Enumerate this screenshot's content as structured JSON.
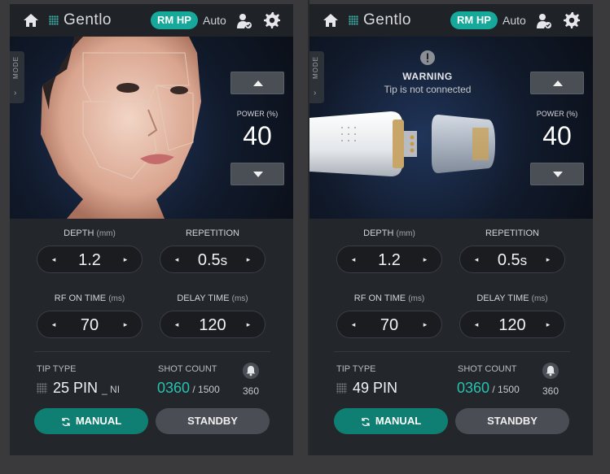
{
  "header": {
    "brand": "Gentlo",
    "mode_badge": "RM HP",
    "auto_label": "Auto"
  },
  "side_tab": {
    "label": "MODE",
    "chevron": "›"
  },
  "power": {
    "label": "POWER",
    "unit": "(%)",
    "value": "40"
  },
  "warning": {
    "title": "WARNING",
    "message": "Tip is not connected"
  },
  "controls": {
    "depth": {
      "label": "DEPTH",
      "unit": "(mm)",
      "value": "1.2"
    },
    "repetition": {
      "label": "REPETITION",
      "value": "0.5",
      "suffix": "s"
    },
    "rf_on_time": {
      "label": "RF ON TIME",
      "unit": "(ms)",
      "value": "70"
    },
    "delay_time": {
      "label": "DELAY TIME",
      "unit": "(ms)",
      "value": "120"
    },
    "left_arrow": "◂",
    "right_arrow": "▸"
  },
  "panels": [
    {
      "tip_type_label": "TIP TYPE",
      "tip_value": "25 PIN",
      "tip_suffix": "_ NI",
      "shot_label": "SHOT COUNT",
      "shot_current": "0360",
      "shot_total": " / 1500",
      "bell_count": "360"
    },
    {
      "tip_type_label": "TIP TYPE",
      "tip_value": "49 PIN",
      "tip_suffix": "",
      "shot_label": "SHOT COUNT",
      "shot_current": "0360",
      "shot_total": " / 1500",
      "bell_count": "360"
    }
  ],
  "buttons": {
    "manual": "MANUAL",
    "standby": "STANDBY"
  },
  "colors": {
    "accent": "#16a89a",
    "shot_count": "#28c2b0",
    "panel_bg": "#23262b"
  }
}
